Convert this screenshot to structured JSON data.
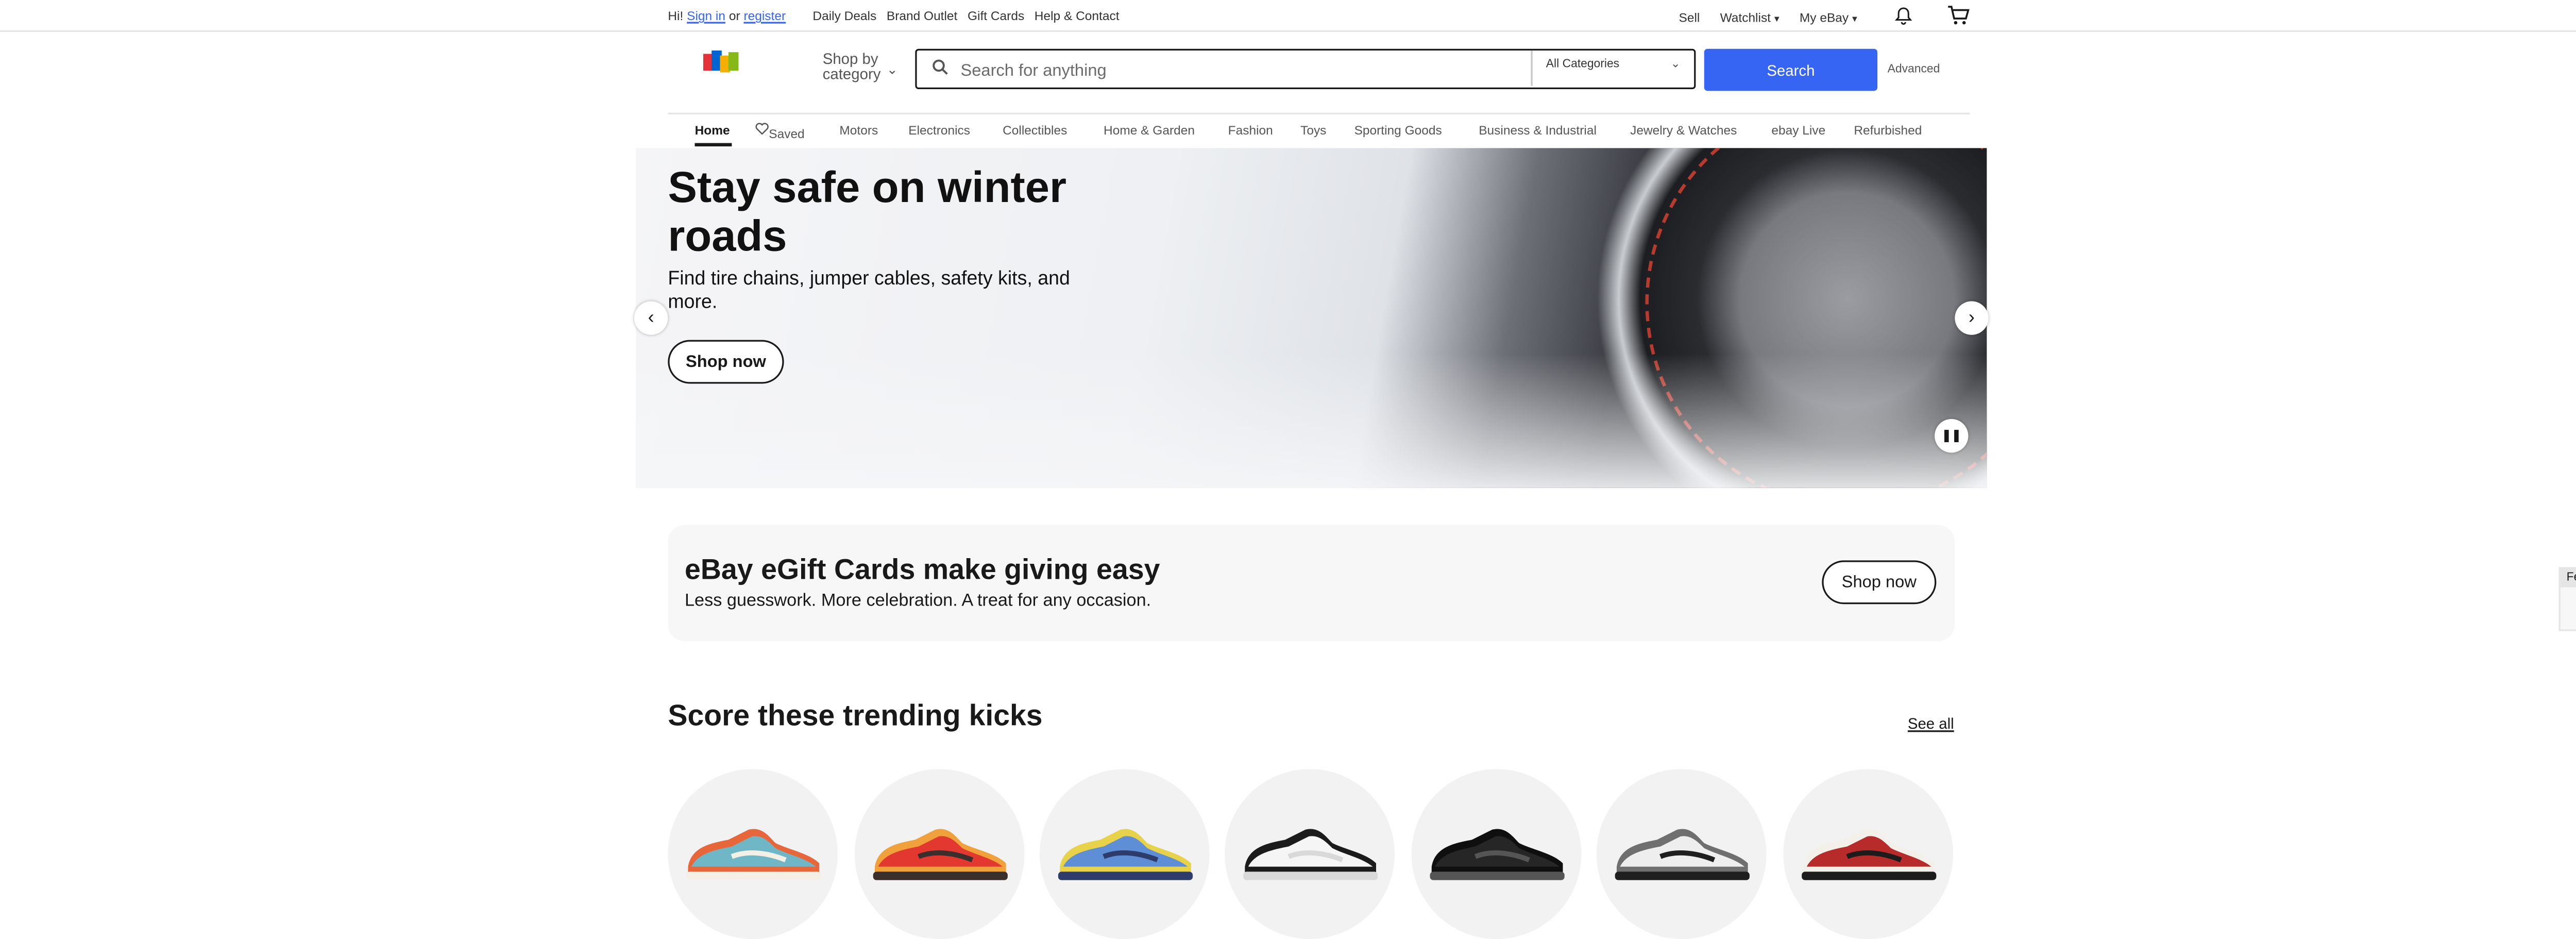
{
  "topbar": {
    "greeting": "Hi!",
    "sign_in": "Sign in",
    "or": "or",
    "register": "register",
    "links": [
      "Daily Deals",
      "Brand Outlet",
      "Gift Cards",
      "Help & Contact"
    ],
    "sell": "Sell",
    "watchlist": "Watchlist",
    "my_ebay": "My eBay"
  },
  "header": {
    "shop_by_line1": "Shop by",
    "shop_by_line2": "category",
    "search_placeholder": "Search for anything",
    "category_select": "All Categories",
    "search_button": "Search",
    "advanced": "Advanced"
  },
  "nav": {
    "items": [
      "Home",
      "Saved",
      "Motors",
      "Electronics",
      "Collectibles",
      "Home & Garden",
      "Fashion",
      "Toys",
      "Sporting Goods",
      "Business & Industrial",
      "Jewelry & Watches",
      "ebay Live",
      "Refurbished"
    ]
  },
  "hero": {
    "title": "Stay safe on winter roads",
    "subtitle": "Find tire chains, jumper cables, safety kits, and more.",
    "cta": "Shop now",
    "pause_icon": "pause-icon"
  },
  "gift": {
    "title": "eBay eGift Cards make giving easy",
    "subtitle": "Less guesswork. More celebration. A treat for any occasion.",
    "cta": "Shop now"
  },
  "trending": {
    "title": "Score these trending kicks",
    "see_all": "See all",
    "items": [
      {
        "name": "sneaker-teal-orange",
        "colors": [
          "#6fb6c7",
          "#e7673a",
          "#f4f0e6"
        ]
      },
      {
        "name": "sneaker-red",
        "colors": [
          "#e2382f",
          "#f0a13c",
          "#3a2f2c"
        ]
      },
      {
        "name": "sneaker-blue-yellow",
        "colors": [
          "#5e8fd6",
          "#e8d24a",
          "#2e3c6b"
        ]
      },
      {
        "name": "sneaker-white-black",
        "colors": [
          "#f5f5f5",
          "#1b1b1b",
          "#d9d9d9"
        ]
      },
      {
        "name": "sneaker-black",
        "colors": [
          "#262626",
          "#0f0f0f",
          "#555555"
        ]
      },
      {
        "name": "sneaker-grey-white",
        "colors": [
          "#eeeeee",
          "#6f6f6f",
          "#1f1f1f"
        ]
      },
      {
        "name": "sneaker-red-white",
        "colors": [
          "#b72b2a",
          "#f3f0ea",
          "#1c1c1c"
        ]
      }
    ]
  },
  "feedback": {
    "label": "Feedback"
  },
  "colors": {
    "accent": "#3665f3",
    "text": "#191919"
  }
}
